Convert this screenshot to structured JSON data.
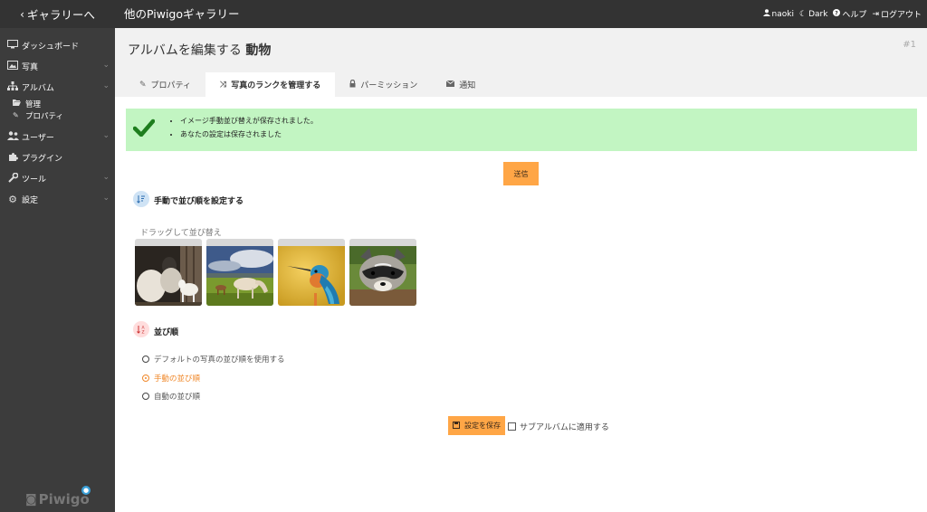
{
  "topbar": {
    "back_label": "ギャラリーへ",
    "gallery_title": "他のPiwigoギャラリー",
    "user": "naoki",
    "theme": "Dark",
    "help": "ヘルプ",
    "logout": "ログアウト"
  },
  "sidebar": {
    "items": [
      {
        "label": "ダッシュボード",
        "icon": "monitor-icon"
      },
      {
        "label": "写真",
        "icon": "image-icon"
      },
      {
        "label": "アルバム",
        "icon": "sitemap-icon"
      },
      {
        "label": "ユーザー",
        "icon": "users-icon"
      },
      {
        "label": "プラグイン",
        "icon": "puzzle-icon"
      },
      {
        "label": "ツール",
        "icon": "wrench-icon"
      },
      {
        "label": "設定",
        "icon": "gear-icon"
      }
    ],
    "album_sub": [
      {
        "label": "管理",
        "icon": "folder-open-icon"
      },
      {
        "label": "プロパティ",
        "icon": "pencil-icon"
      }
    ],
    "logo_text": "Piwigo"
  },
  "header": {
    "title_prefix": "アルバムを編集する",
    "album_name": "動物",
    "album_id": "#1"
  },
  "tabs": [
    {
      "label": "プロパティ",
      "icon": "pencil-icon",
      "active": false
    },
    {
      "label": "写真のランクを管理する",
      "icon": "shuffle-icon",
      "active": true
    },
    {
      "label": "パーミッション",
      "icon": "lock-icon",
      "active": false
    },
    {
      "label": "通知",
      "icon": "envelope-icon",
      "active": false
    }
  ],
  "messages": [
    "イメージ手動並び替えが保存されました。",
    "あなたの設定は保存されました"
  ],
  "submit_label": "送信",
  "manual_section": {
    "title": "手動で並び順を設定する",
    "drag_label": "ドラッグして並び替え"
  },
  "sort_section": {
    "title": "並び順",
    "options": [
      {
        "label": "デフォルトの写真の並び順を使用する",
        "selected": false
      },
      {
        "label": "手動の並び順",
        "selected": true
      },
      {
        "label": "自動の並び順",
        "selected": false
      }
    ]
  },
  "save_label": "設定を保存",
  "apply_subalbums_label": "サブアルバムに適用する",
  "colors": {
    "accent": "#ffa646",
    "success_bg": "#c2f5c2",
    "topbar": "#333333",
    "sidebar": "#3c3c3c"
  }
}
